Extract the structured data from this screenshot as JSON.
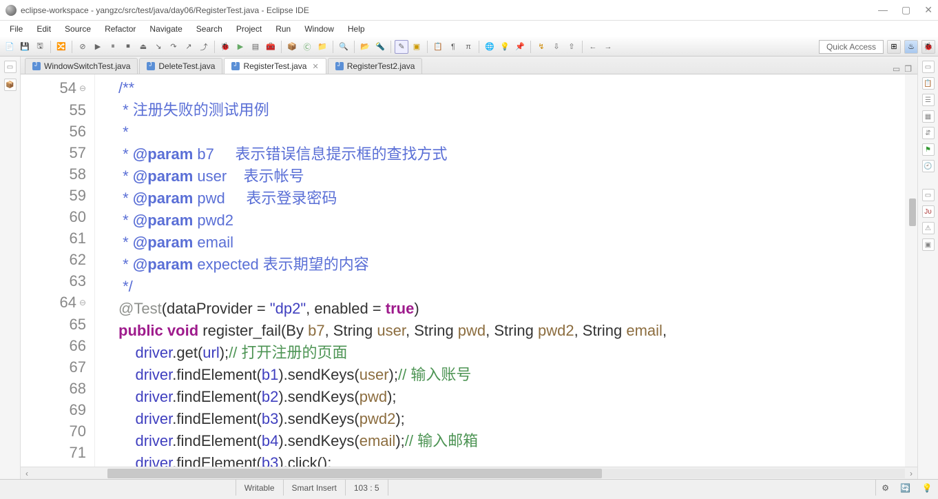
{
  "title": "eclipse-workspace - yangzc/src/test/java/day06/RegisterTest.java - Eclipse IDE",
  "menu": [
    "File",
    "Edit",
    "Source",
    "Refactor",
    "Navigate",
    "Search",
    "Project",
    "Run",
    "Window",
    "Help"
  ],
  "quick_access": "Quick Access",
  "tabs": [
    {
      "label": "WindowSwitchTest.java",
      "active": false
    },
    {
      "label": "DeleteTest.java",
      "active": false
    },
    {
      "label": "RegisterTest.java",
      "active": true
    },
    {
      "label": "RegisterTest2.java",
      "active": false
    }
  ],
  "lines": [
    "54",
    "55",
    "56",
    "57",
    "58",
    "59",
    "60",
    "61",
    "62",
    "63",
    "64",
    "65",
    "66",
    "67",
    "68",
    "69",
    "70",
    "71"
  ],
  "code": {
    "l54": "/**",
    "l55a": " * ",
    "l55b": "注册失败的测试用例",
    "l56": " * ",
    "l57a": " * ",
    "l57tag": "@param",
    "l57b": " b7     ",
    "l57c": "表示错误信息提示框的查找方式",
    "l58a": " * ",
    "l58tag": "@param",
    "l58b": " user    ",
    "l58c": "表示帐号",
    "l59a": " * ",
    "l59tag": "@param",
    "l59b": " pwd     ",
    "l59c": "表示登录密码",
    "l60a": " * ",
    "l60tag": "@param",
    "l60b": " pwd2",
    "l61a": " * ",
    "l61tag": "@param",
    "l61b": " email",
    "l62a": " * ",
    "l62tag": "@param",
    "l62b": " expected ",
    "l62c": "表示期望的内容",
    "l63": " */",
    "l64a": "@Test",
    "l64b": "(dataProvider = ",
    "l64c": "\"dp2\"",
    "l64d": ", enabled = ",
    "l64e": "true",
    "l64f": ")",
    "l65a": "public",
    "l65b": " ",
    "l65c": "void",
    "l65d": " register_fail(By ",
    "l65e": "b7",
    "l65f": ", String ",
    "l65g": "user",
    "l65h": ", String ",
    "l65i": "pwd",
    "l65j": ", String ",
    "l65k": "pwd2",
    "l65l": ", String ",
    "l65m": "email",
    "l65n": ",",
    "l66a": "    ",
    "l66b": "driver",
    "l66c": ".get(",
    "l66d": "url",
    "l66e": ");",
    "l66f": "// 打开注册的页面",
    "l67a": "    ",
    "l67b": "driver",
    "l67c": ".findElement(",
    "l67d": "b1",
    "l67e": ").sendKeys(",
    "l67f": "user",
    "l67g": ");",
    "l67h": "// 输入账号",
    "l68a": "    ",
    "l68b": "driver",
    "l68c": ".findElement(",
    "l68d": "b2",
    "l68e": ").sendKeys(",
    "l68f": "pwd",
    "l68g": ");",
    "l69a": "    ",
    "l69b": "driver",
    "l69c": ".findElement(",
    "l69d": "b3",
    "l69e": ").sendKeys(",
    "l69f": "pwd2",
    "l69g": ");",
    "l70a": "    ",
    "l70b": "driver",
    "l70c": ".findElement(",
    "l70d": "b4",
    "l70e": ").sendKeys(",
    "l70f": "email",
    "l70g": ");",
    "l70h": "// 输入邮箱",
    "l71a": "    ",
    "l71b": "driver",
    "l71c": ".findElement(",
    "l71d": "b3",
    "l71e": ").click();"
  },
  "status": {
    "writable": "Writable",
    "insert": "Smart Insert",
    "pos": "103 : 5"
  }
}
